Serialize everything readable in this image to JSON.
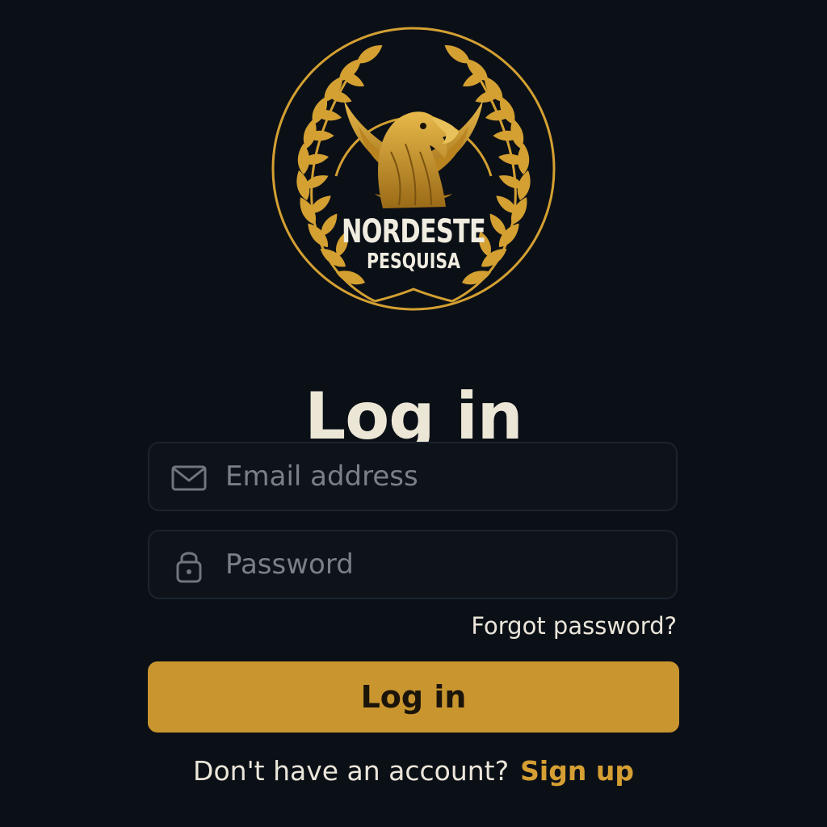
{
  "brand": {
    "logo_line1": "NORDESTE",
    "logo_line2": "PESQUISA",
    "colors": {
      "gold": "#d4a032",
      "gold_dark": "#a8761c",
      "background": "#0b1017"
    },
    "icon": "eagle-laurel-emblem"
  },
  "page": {
    "title": "Log in"
  },
  "form": {
    "email": {
      "placeholder": "Email address",
      "value": "",
      "icon": "envelope-icon"
    },
    "password": {
      "placeholder": "Password",
      "value": "",
      "icon": "lock-icon"
    },
    "forgot_password": "Forgot password?",
    "submit_label": "Log in"
  },
  "footer": {
    "prompt": "Don't have an account?",
    "signup_label": "Sign up"
  },
  "colors": {
    "accent": "#c9952f",
    "link": "#d59f33",
    "text": "#ebe6da",
    "placeholder": "#7b8087",
    "field_border": "#1b232d"
  }
}
